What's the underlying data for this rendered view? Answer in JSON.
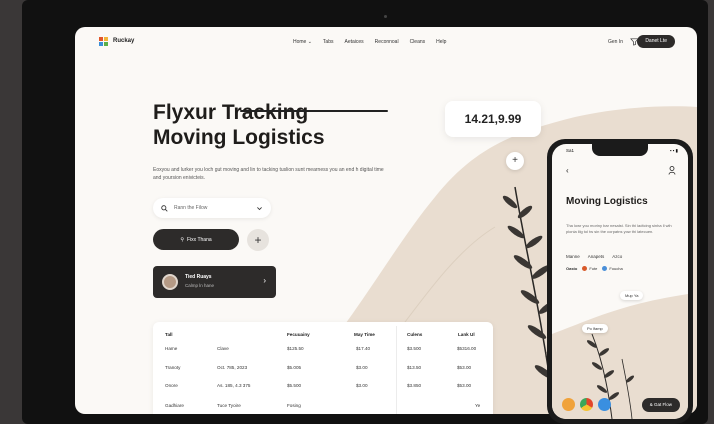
{
  "nav": {
    "logo": "Ruckay",
    "links": [
      "Home ⌄",
      "Tabs",
      "Aetaices",
      "Reconnoal",
      "Cleans",
      "Help"
    ],
    "sign_in": "Gen In",
    "cta": "Danet Lte"
  },
  "hero": {
    "title_line1": "Flyxur Tracking",
    "title_line2": "Moving Logistics",
    "subtitle": "Eoxyou and lurker you loch gut moving and lin to tacking tuslion sunt mearness you an end h digital time and yoursion enivicteis.",
    "search_placeholder": "Rann the Filow",
    "primary_button": "Fixx Thana",
    "account_name": "Tied Ruays",
    "account_status": "Calmp ln hane"
  },
  "price_tag": "14.21,9.99",
  "table": {
    "headers": [
      "Tall",
      "Fecuuainy",
      "May Time",
      "Culens",
      "Lank Ul"
    ],
    "rows": [
      [
        "Hame",
        "Clave",
        "$125.50",
        "$17.40",
        "$3.500",
        "$5316.00"
      ],
      [
        "Tranoty",
        "Oct. 785, 2023",
        "$5.005",
        "$3.00",
        "$13.50",
        "$53.00"
      ],
      [
        "Onore",
        "As. 185, 4.3 375",
        "$5.500",
        "$3.00",
        "$3.850",
        "$53.00"
      ],
      [
        "Gadhiare",
        "Tuce Tyoire",
        "Fosing",
        "",
        "",
        "Ye"
      ]
    ]
  },
  "phone": {
    "time": "Sa1",
    "status": "▪ ▪ ▮",
    "title": "Moving Logistics",
    "description": "Tha lowr you moriny bar nesalst. Sin thi ladtcing sinha ll wih pionia lilg tol tw sin the corpatns yow thi latecuen.",
    "tabs": [
      "Manne",
      "Anapets",
      "Azco"
    ],
    "legend_label": "Oasto",
    "legend_items": [
      "Fute",
      "Foucha"
    ],
    "chip1": "Mup Ya",
    "chip2": "Po lfamp",
    "cta": "& Gat Flow"
  },
  "colors": {
    "accent_dark": "#2d2b2a",
    "sand": "#e9ddd0",
    "bg": "#fbf9f6"
  }
}
